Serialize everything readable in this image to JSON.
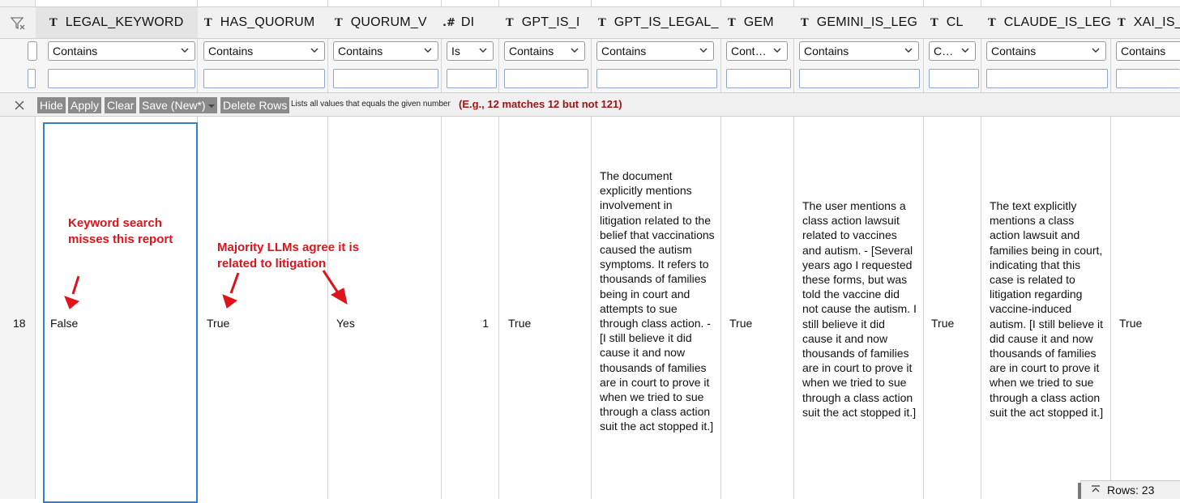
{
  "columns": [
    {
      "type_icon": "T",
      "header": "LEGAL_KEYWORD",
      "filter_op": "Contains",
      "cell": "False"
    },
    {
      "type_icon": "T",
      "header": "HAS_QUORUM",
      "filter_op": "Contains",
      "cell": "True"
    },
    {
      "type_icon": "T",
      "header": "QUORUM_V",
      "filter_op": "Contains",
      "cell": "Yes"
    },
    {
      "type_icon": ".#",
      "header": "DI",
      "filter_op": "Is",
      "cell": "1"
    },
    {
      "type_icon": "T",
      "header": "GPT_IS_I",
      "filter_op": "Contains",
      "cell": "True"
    },
    {
      "type_icon": "T",
      "header": "GPT_IS_LEGAL_",
      "filter_op": "Contains",
      "cell": "The document explicitly mentions involvement in litigation related to the belief that vaccinations caused the autism symptoms. It refers to thousands of families being in court and attempts to sue through class action. - [I still believe it did cause it and now thousands of families are in court to prove it when we tried to sue through a class action suit the act stopped it.]"
    },
    {
      "type_icon": "T",
      "header": "GEM",
      "filter_op": "Cont…",
      "cell": "True"
    },
    {
      "type_icon": "T",
      "header": "GEMINI_IS_LEG",
      "filter_op": "Contains",
      "cell": "The user mentions a class action lawsuit related to vaccines and autism. - [Several years ago I requested these forms, but was told the vaccine did not cause the autism. I still believe it did cause it and now thousands of families are in court to prove it when we tried to sue through a class action suit the act stopped it.]"
    },
    {
      "type_icon": "T",
      "header": "CL",
      "filter_op": "C…",
      "cell": "True"
    },
    {
      "type_icon": "T",
      "header": "CLAUDE_IS_LEG",
      "filter_op": "Contains",
      "cell": "The text explicitly mentions a class action lawsuit and families being in court, indicating that this case is related to litigation regarding vaccine-induced autism. [I still believe it did cause it and now thousands of families are in court to prove it when we tried to sue through a class action suit the act stopped it.]"
    },
    {
      "type_icon": "T",
      "header": "XAI_IS_L",
      "filter_op": "Contains",
      "cell": "True"
    }
  ],
  "toolbar": {
    "hide": "Hide",
    "apply": "Apply",
    "clear": "Clear",
    "save": "Save (New*)",
    "delete_rows": "Delete Rows",
    "note": "Lists all values that equals the given number",
    "example": "(E.g., 12 matches 12 but not 121)"
  },
  "row": {
    "number": "18"
  },
  "annotations": {
    "keyword": "Keyword search misses this report",
    "majority": "Majority LLMs agree it is related to litigation"
  },
  "footer": {
    "rows_label": "Rows: 23"
  },
  "colors": {
    "annotation": "#e0131b",
    "selection": "#2f7fd4",
    "example_text": "#a01414"
  }
}
